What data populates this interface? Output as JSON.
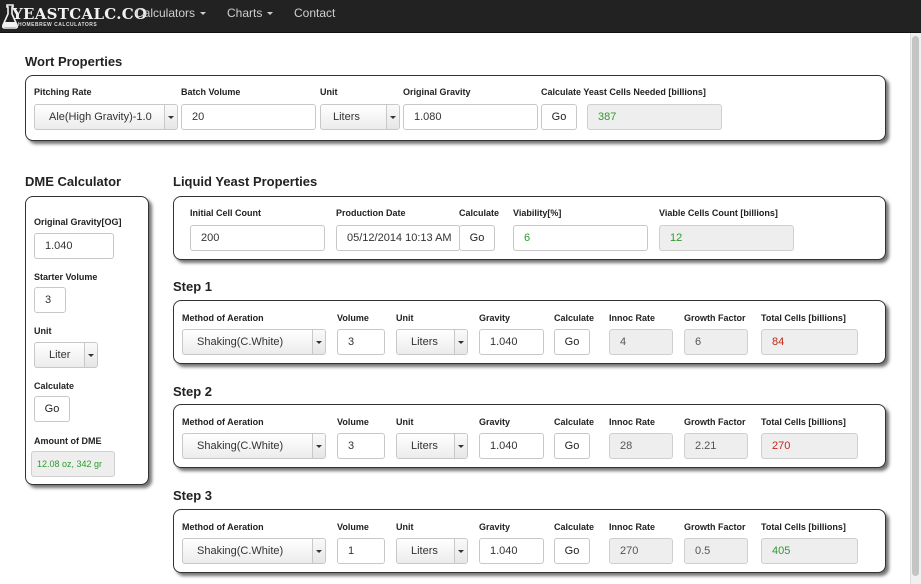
{
  "nav": {
    "brand_title": "YEASTCALC.CO",
    "brand_subtitle": "HOMEBREW CALCULATORS",
    "brand_icon": "flask-icon",
    "items": [
      {
        "label": "Calculators",
        "dropdown": true
      },
      {
        "label": "Charts",
        "dropdown": true
      },
      {
        "label": "Contact",
        "dropdown": false
      }
    ]
  },
  "colors": {
    "navbar": "#222222",
    "green_value": "#2e9b2e",
    "red_value": "#c0261b"
  },
  "wort": {
    "heading": "Wort Properties",
    "pitching_rate_label": "Pitching Rate",
    "pitching_rate_value": "Ale(High Gravity)-1.0",
    "batch_volume_label": "Batch Volume",
    "batch_volume_value": "20",
    "unit_label": "Unit",
    "unit_value": "Liters",
    "og_label": "Original Gravity",
    "og_value": "1.080",
    "calc_label": "Calculate Yeast Cells Needed [billions]",
    "go_label": "Go",
    "cells_needed": "387"
  },
  "dme": {
    "heading": "DME Calculator",
    "og_label": "Original Gravity[OG]",
    "og_value": "1.040",
    "starter_volume_label": "Starter Volume",
    "starter_volume_value": "3",
    "unit_label": "Unit",
    "unit_value": "Liter",
    "calc_label": "Calculate",
    "go_label": "Go",
    "amount_label": "Amount of DME",
    "amount_value": "12.08 oz, 342 gr"
  },
  "liquid": {
    "heading": "Liquid Yeast Properties",
    "initial_count_label": "Initial Cell Count",
    "initial_count_value": "200",
    "production_date_label": "Production Date",
    "production_date_value": "05/12/2014 10:13 AM",
    "calc_label": "Calculate",
    "go_label": "Go",
    "viability_label": "Viability[%]",
    "viability_value": "6",
    "viable_cells_label": "Viable Cells Count [billions]",
    "viable_cells_value": "12"
  },
  "step_labels": {
    "aeration": "Method of Aeration",
    "volume": "Volume",
    "unit": "Unit",
    "gravity": "Gravity",
    "calculate": "Calculate",
    "innoc": "Innoc Rate",
    "growth": "Growth Factor",
    "total": "Total Cells [billions]",
    "go": "Go"
  },
  "steps": [
    {
      "heading": "Step 1",
      "aeration": "Shaking(C.White)",
      "volume": "3",
      "unit": "Liters",
      "gravity": "1.040",
      "innoc_rate": "4",
      "growth_factor": "6",
      "total_cells": "84",
      "total_status": "red"
    },
    {
      "heading": "Step 2",
      "aeration": "Shaking(C.White)",
      "volume": "3",
      "unit": "Liters",
      "gravity": "1.040",
      "innoc_rate": "28",
      "growth_factor": "2.21",
      "total_cells": "270",
      "total_status": "red"
    },
    {
      "heading": "Step 3",
      "aeration": "Shaking(C.White)",
      "volume": "1",
      "unit": "Liters",
      "gravity": "1.040",
      "innoc_rate": "270",
      "growth_factor": "0.5",
      "total_cells": "405",
      "total_status": "green"
    }
  ]
}
